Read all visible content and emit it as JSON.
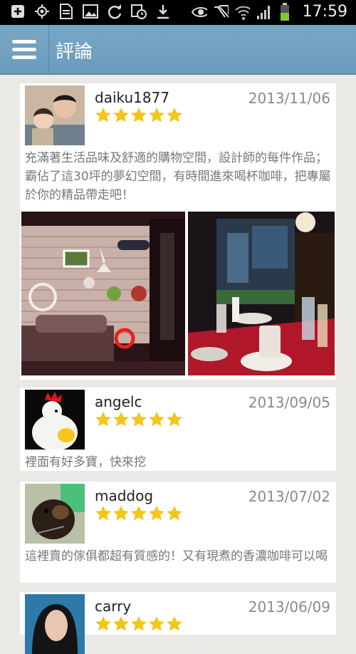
{
  "status_bar": {
    "time": "17:59",
    "icons_left": [
      "add-box-icon",
      "gps-icon",
      "document-icon",
      "image-icon",
      "sync-icon",
      "calendar-clock-icon",
      "download-icon"
    ],
    "icons_right": [
      "eye-icon",
      "mute-icon",
      "wifi-icon",
      "signal-icon",
      "battery-icon"
    ]
  },
  "app_bar": {
    "title": "評論"
  },
  "reviews": [
    {
      "user": "daiku1877",
      "date": "2013/11/06",
      "rating": 5,
      "comment": "充滿著生活品味及舒適的購物空間，設計師的每件作品；霸佔了這30坪的夢幻空間，有時間進來喝杯咖啡，把專屬於你的精品帶走吧！"
    },
    {
      "user": "angelc",
      "date": "2013/09/05",
      "rating": 5,
      "comment": "裡面有好多寶，快來挖"
    },
    {
      "user": "maddog",
      "date": "2013/07/02",
      "rating": 5,
      "comment": "這裡賣的傢俱都超有質感的！又有現煮的香濃咖啡可以喝"
    },
    {
      "user": "carry",
      "date": "2013/06/09",
      "rating": 5,
      "comment": ""
    }
  ],
  "colors": {
    "app_bar": "#6f9fbf",
    "star": "#f5c518",
    "background": "#ebe9e6"
  }
}
